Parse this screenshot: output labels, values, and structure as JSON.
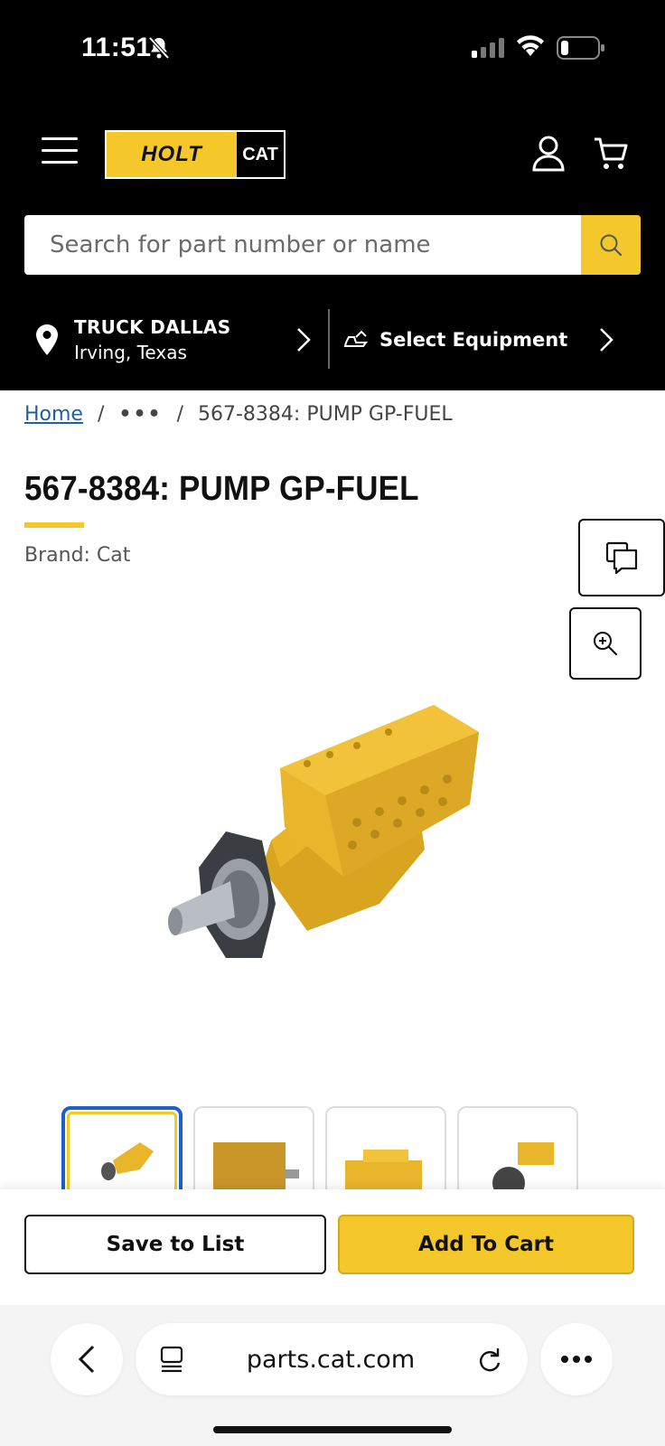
{
  "status_bar": {
    "time": "11:51"
  },
  "header": {
    "logo_left": "HOLT",
    "logo_right": "CAT",
    "search_placeholder": "Search for part number or name",
    "store": {
      "name": "TRUCK DALLAS",
      "location": "Irving, Texas"
    },
    "equipment_label": "Select Equipment"
  },
  "breadcrumb": {
    "home": "Home",
    "ellipsis": "•••",
    "current": "567-8384: PUMP GP-FUEL",
    "separator": "/"
  },
  "product": {
    "title": "567-8384: PUMP GP-FUEL",
    "brand": "Brand: Cat"
  },
  "actions": {
    "save": "Save to List",
    "add": "Add To Cart"
  },
  "browser": {
    "url": "parts.cat.com"
  },
  "colors": {
    "accent": "#f4c82b",
    "link": "#1f5fa6",
    "thumb_selected": "#1d5fcf"
  }
}
